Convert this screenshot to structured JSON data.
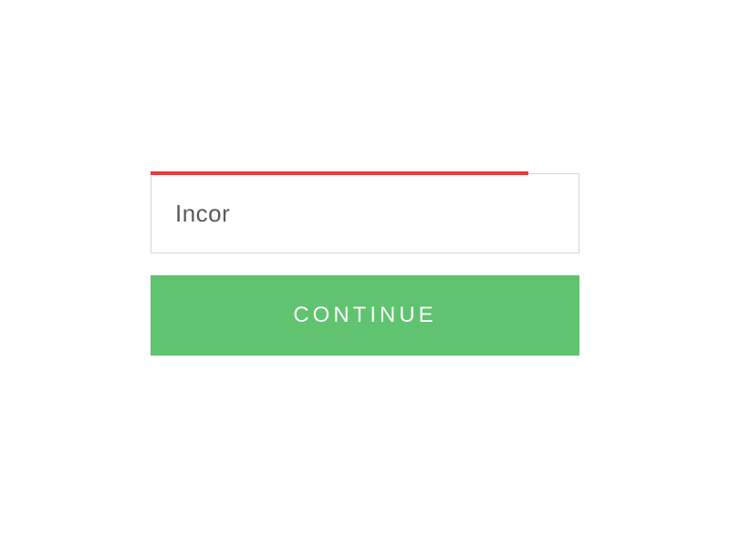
{
  "form": {
    "input_value": "Incor",
    "progress_bar_color": "#e83a3a",
    "continue_label": "CONTINUE",
    "button_color": "#5fc36f"
  }
}
